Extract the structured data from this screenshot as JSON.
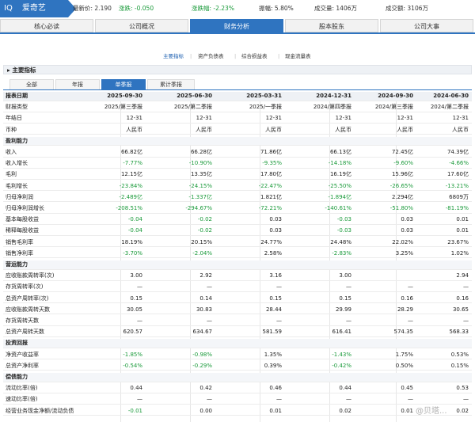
{
  "header": {
    "code": "IQ",
    "name": "爱奇艺",
    "latest_price": "最新价: 2.190",
    "change": "涨跌: -0.050",
    "change_pct": "涨跌幅: -2.23%",
    "amplitude": "振幅: 5.80%",
    "volume": "成交量: 1406万",
    "turnover": "成交额: 3106万"
  },
  "tabs": [
    "核心必读",
    "公司概况",
    "财务分析",
    "股本股东",
    "公司大事"
  ],
  "subtabs": [
    "主要指标",
    "资产负债表",
    "综合损益表",
    "现金流量表"
  ],
  "section_title": "▸ 主要指标",
  "periods": [
    "全部",
    "年报",
    "单季报",
    "累计季报"
  ],
  "table": {
    "rows": [
      {
        "t": "head",
        "label": "报表日期",
        "v": [
          "2025-09-30",
          "2025-06-30",
          "2025-03-31",
          "2024-12-31",
          "2024-09-30",
          "2024-06-30"
        ]
      },
      {
        "t": "row",
        "label": "财报类型",
        "v": [
          "2025/第三季报",
          "2025/第二季报",
          "2025/一季报",
          "2024/第四季报",
          "2024/第三季报",
          "2024/第二季报"
        ]
      },
      {
        "t": "row",
        "label": "年结日",
        "v": [
          "12-31",
          "12-31",
          "12-31",
          "12-31",
          "12-31",
          "12-31"
        ]
      },
      {
        "t": "row",
        "label": "币种",
        "v": [
          "人民币",
          "人民币",
          "人民币",
          "人民币",
          "人民币",
          "人民币"
        ]
      },
      {
        "t": "cat",
        "label": "盈利能力",
        "v": [
          "",
          "",
          "",
          "",
          "",
          ""
        ]
      },
      {
        "t": "row",
        "label": "收入",
        "v": [
          "66.82亿",
          "66.28亿",
          "71.86亿",
          "66.13亿",
          "72.45亿",
          "74.39亿"
        ]
      },
      {
        "t": "row",
        "label": "收入增长",
        "v": [
          "-7.77%",
          "-10.90%",
          "-9.35%",
          "-14.18%",
          "-9.60%",
          "-4.66%"
        ]
      },
      {
        "t": "row",
        "label": "毛利",
        "v": [
          "12.15亿",
          "13.35亿",
          "17.80亿",
          "16.19亿",
          "15.96亿",
          "17.60亿"
        ]
      },
      {
        "t": "row",
        "label": "毛利增长",
        "v": [
          "-23.84%",
          "-24.15%",
          "-22.47%",
          "-25.50%",
          "-26.65%",
          "-13.21%"
        ]
      },
      {
        "t": "row",
        "label": "归母净利润",
        "v": [
          "-2.489亿",
          "-1.337亿",
          "1.821亿",
          "-1.894亿",
          "2.294亿",
          "6809万"
        ]
      },
      {
        "t": "row",
        "label": "归母净利润增长",
        "v": [
          "-208.51%",
          "-294.67%",
          "-72.21%",
          "-140.61%",
          "-51.80%",
          "-81.19%"
        ]
      },
      {
        "t": "row",
        "label": "基本每股收益",
        "v": [
          "-0.04",
          "-0.02",
          "0.03",
          "-0.03",
          "0.03",
          "0.01"
        ]
      },
      {
        "t": "row",
        "label": "稀释每股收益",
        "v": [
          "-0.04",
          "-0.02",
          "0.03",
          "-0.03",
          "0.03",
          "0.01"
        ]
      },
      {
        "t": "row",
        "label": "销售毛利率",
        "v": [
          "18.19%",
          "20.15%",
          "24.77%",
          "24.48%",
          "22.02%",
          "23.67%"
        ]
      },
      {
        "t": "row",
        "label": "销售净利率",
        "v": [
          "-3.70%",
          "-2.04%",
          "2.58%",
          "-2.83%",
          "3.25%",
          "1.02%"
        ]
      },
      {
        "t": "cat",
        "label": "营运能力",
        "v": [
          "",
          "",
          "",
          "",
          "",
          ""
        ]
      },
      {
        "t": "row",
        "label": "应收账款周转率(次)",
        "v": [
          "3.00",
          "2.92",
          "3.16",
          "3.00",
          "",
          "2.94"
        ]
      },
      {
        "t": "row",
        "label": "存货周转率(次)",
        "v": [
          "—",
          "—",
          "—",
          "—",
          "—",
          "—"
        ]
      },
      {
        "t": "row",
        "label": "总资产周转率(次)",
        "v": [
          "0.15",
          "0.14",
          "0.15",
          "0.15",
          "0.16",
          "0.16"
        ]
      },
      {
        "t": "row",
        "label": "应收账款周转天数",
        "v": [
          "30.05",
          "30.83",
          "28.44",
          "29.99",
          "28.29",
          "30.65"
        ]
      },
      {
        "t": "row",
        "label": "存货周转天数",
        "v": [
          "—",
          "—",
          "—",
          "—",
          "—",
          "—"
        ]
      },
      {
        "t": "row",
        "label": "总资产周转天数",
        "v": [
          "620.57",
          "634.67",
          "581.59",
          "616.41",
          "574.35",
          "568.33"
        ]
      },
      {
        "t": "cat",
        "label": "投资回报",
        "v": [
          "",
          "",
          "",
          "",
          "",
          ""
        ]
      },
      {
        "t": "row",
        "label": "净资产收益率",
        "v": [
          "-1.85%",
          "-0.98%",
          "1.35%",
          "-1.43%",
          "1.75%",
          "0.53%"
        ]
      },
      {
        "t": "row",
        "label": "总资产净利率",
        "v": [
          "-0.54%",
          "-0.29%",
          "0.39%",
          "-0.42%",
          "0.50%",
          "0.15%"
        ]
      },
      {
        "t": "cat",
        "label": "偿债能力",
        "v": [
          "",
          "",
          "",
          "",
          "",
          ""
        ]
      },
      {
        "t": "row",
        "label": "流动比率(倍)",
        "v": [
          "0.44",
          "0.42",
          "0.46",
          "0.44",
          "0.45",
          "0.53"
        ]
      },
      {
        "t": "row",
        "label": "速动比率(倍)",
        "v": [
          "—",
          "—",
          "—",
          "—",
          "—",
          "—"
        ]
      },
      {
        "t": "row",
        "label": "经营业务现金净额/流动负债",
        "v": [
          "-0.01",
          "0.00",
          "0.01",
          "0.02",
          "0.01",
          "0.02"
        ]
      }
    ]
  },
  "watermark": "@贝塔..."
}
